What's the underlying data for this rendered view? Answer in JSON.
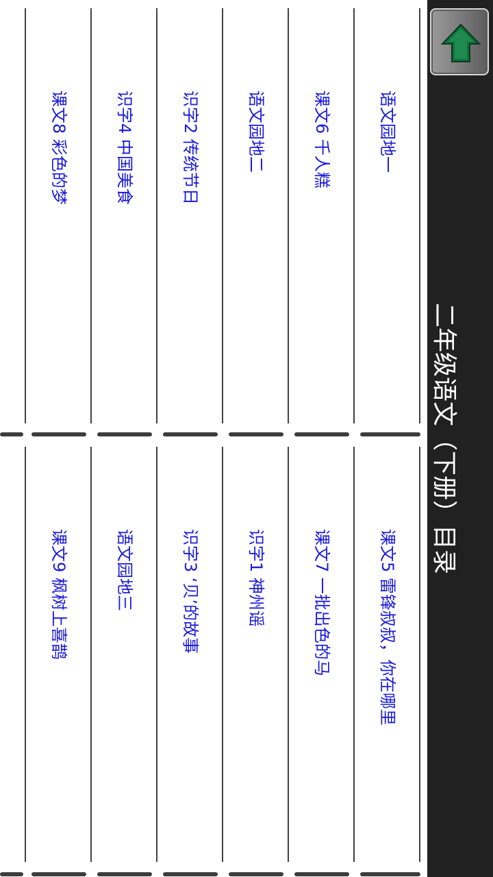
{
  "header": {
    "title": "二年级语文（下册）目录",
    "home_icon": "home-up-arrow-icon"
  },
  "lessons_top": [
    {
      "label": "语文园地一"
    },
    {
      "label": "课文6   千人糕"
    },
    {
      "label": "语文园地二"
    },
    {
      "label": "识字2   传统节日"
    },
    {
      "label": "识字4   中国美食"
    },
    {
      "label": "课文8   彩色的梦"
    }
  ],
  "lessons_bottom": [
    {
      "label": "课文5   雷锋叔叔，你在哪里"
    },
    {
      "label": "课文7   一批出色的马"
    },
    {
      "label": "识字1   神州谣"
    },
    {
      "label": "识字3   ‘贝’的故事"
    },
    {
      "label": "语文园地三"
    },
    {
      "label": "课文9   枫树上喜鹊"
    }
  ],
  "colors": {
    "header_bg": "#212121",
    "link_text": "#1a1adb",
    "rule": "#404040"
  }
}
